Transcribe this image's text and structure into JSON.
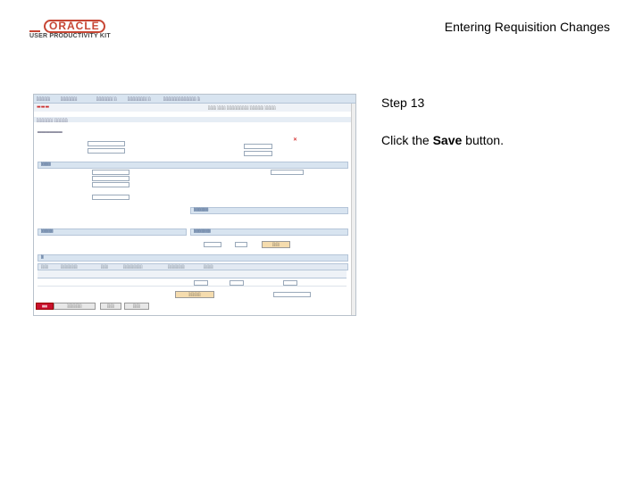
{
  "header": {
    "logo_brand": "ORACLE",
    "logo_product": "USER PRODUCTIVITY KIT",
    "title": "Entering Requisition Changes"
  },
  "instructions": {
    "step": "Step 13",
    "text_before": "Click the ",
    "text_bold": "Save",
    "text_after": " button."
  },
  "colors": {
    "oracle_red": "#c74634",
    "accent_blue": "#d8e4f0"
  }
}
